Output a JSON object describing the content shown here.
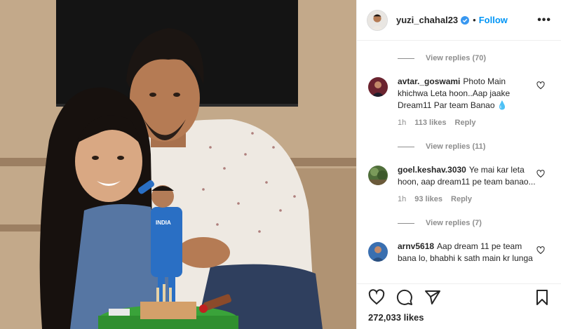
{
  "post": {
    "username": "yuzi_chahal23",
    "follow_label": "Follow",
    "more_label": "•••",
    "separator": "•",
    "likes": "272,033 likes"
  },
  "comments": [
    {
      "type": "view_replies",
      "label": "View replies (70)"
    },
    {
      "type": "comment",
      "user": "avtar._goswami",
      "text": "Photo Main khichwa Leta hoon..Aap jaake Dream11 Par team Banao 💧",
      "time": "1h",
      "likes": "113 likes",
      "reply": "Reply",
      "avatar_color": "#6b2430"
    },
    {
      "type": "view_replies",
      "label": "View replies (11)"
    },
    {
      "type": "comment",
      "user": "goel.keshav.3030",
      "text": "Ye mai kar leta hoon, aap dream11 pe team banao...",
      "time": "1h",
      "likes": "93 likes",
      "reply": "Reply",
      "avatar_color": "#4f6e3a"
    },
    {
      "type": "view_replies",
      "label": "View replies (7)"
    },
    {
      "type": "comment",
      "user": "arnv5618",
      "text": "Aap dream 11 pe team bana lo, bhabhi k sath main kr lunga",
      "time": "",
      "likes": "",
      "reply": "",
      "avatar_color": "#3a6fb0"
    }
  ],
  "icons": {
    "like": "heart-icon",
    "comment": "comment-icon",
    "share": "share-icon",
    "save": "bookmark-icon",
    "verified": "verified-badge-icon"
  },
  "colors": {
    "accent": "#0095f6",
    "verified": "#3897f0",
    "muted": "#8e8e8e",
    "text": "#262626"
  }
}
